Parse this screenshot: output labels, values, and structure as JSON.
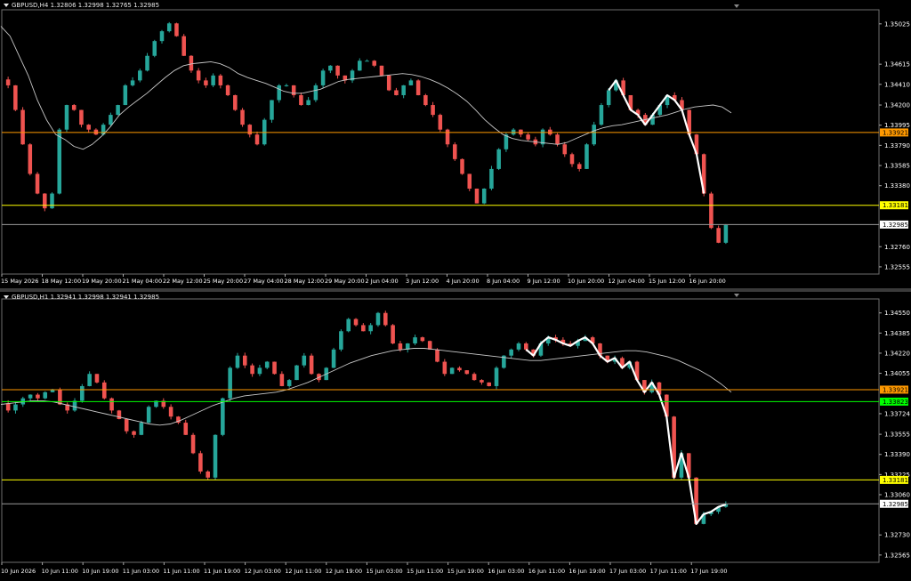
{
  "colors": {
    "bull": "#26a69a",
    "bear": "#ef5350",
    "ma": "#c8c8c8",
    "orange": "#ff9900",
    "yellow": "#ffff00",
    "green": "#00ff00",
    "current": "#9a9a9a",
    "pattern": "#ffffff",
    "axis_text": "#ffffff"
  },
  "chart_data": [
    {
      "type": "candlestick",
      "header": "GBPUSD,H4  1.32806 1.32998 1.32765 1.32985",
      "symbol": "GBPUSD",
      "timeframe": "H4",
      "ohlc": {
        "open": 1.32806,
        "high": 1.32998,
        "low": 1.32765,
        "close": 1.32985
      },
      "ylim": [
        1.325,
        1.3515
      ],
      "y_ticks": [
        "1.35025",
        "1.34615",
        "1.34410",
        "1.34200",
        "1.33995",
        "1.33790",
        "1.33585",
        "1.33380",
        "1.33181",
        "1.32985",
        "1.32760",
        "1.32555"
      ],
      "x_ticks": [
        "15 May 2026",
        "18 May 12:00",
        "19 May 20:00",
        "21 May 04:00",
        "22 May 12:00",
        "25 May 20:00",
        "27 May 04:00",
        "28 May 12:00",
        "29 May 20:00",
        "2 Jun 04:00",
        "3 Jun 12:00",
        "4 Jun 20:00",
        "8 Jun 04:00",
        "9 Jun 12:00",
        "10 Jun 20:00",
        "12 Jun 04:00",
        "15 Jun 12:00",
        "16 Jun 20:00"
      ],
      "levels": [
        {
          "name": "orange-level",
          "value": 1.33921,
          "label": "1.33921",
          "color": "orange"
        },
        {
          "name": "yellow-level",
          "value": 1.33181,
          "label": "1.33181",
          "color": "yellow"
        },
        {
          "name": "current-price",
          "value": 1.32985,
          "label": "1.32985",
          "color": "current"
        }
      ],
      "price_path": [
        1.344,
        1.3415,
        1.338,
        1.335,
        1.333,
        1.3315,
        1.333,
        1.3395,
        1.342,
        1.3415,
        1.34,
        1.3395,
        1.339,
        1.34,
        1.341,
        1.342,
        1.344,
        1.3445,
        1.3455,
        1.347,
        1.3485,
        1.3495,
        1.3503,
        1.349,
        1.347,
        1.3455,
        1.3445,
        1.344,
        1.345,
        1.344,
        1.343,
        1.3415,
        1.34,
        1.339,
        1.338,
        1.3405,
        1.3425,
        1.344,
        1.344,
        1.343,
        1.342,
        1.3425,
        1.344,
        1.3455,
        1.346,
        1.345,
        1.3445,
        1.3455,
        1.3465,
        1.3465,
        1.346,
        1.345,
        1.3435,
        1.343,
        1.344,
        1.3445,
        1.343,
        1.342,
        1.341,
        1.3395,
        1.338,
        1.3365,
        1.335,
        1.3335,
        1.332,
        1.3335,
        1.3355,
        1.3375,
        1.339,
        1.3395,
        1.339,
        1.3385,
        1.338,
        1.3395,
        1.339,
        1.338,
        1.337,
        1.336,
        1.3355,
        1.338,
        1.34,
        1.342,
        1.3435,
        1.3445,
        1.343,
        1.3415,
        1.341,
        1.34,
        1.341,
        1.342,
        1.343,
        1.3425,
        1.3415,
        1.339,
        1.337,
        1.333,
        1.3295,
        1.328,
        1.3298
      ],
      "ma_path": [
        1.35,
        1.349,
        1.347,
        1.345,
        1.3425,
        1.3405,
        1.339,
        1.3385,
        1.3378,
        1.3375,
        1.338,
        1.3388,
        1.3398,
        1.341,
        1.3418,
        1.3425,
        1.3432,
        1.344,
        1.3448,
        1.3455,
        1.346,
        1.3462,
        1.3463,
        1.3464,
        1.3462,
        1.3458,
        1.3452,
        1.3448,
        1.3445,
        1.3442,
        1.3438,
        1.3434,
        1.3432,
        1.3432,
        1.3434,
        1.3436,
        1.344,
        1.3444,
        1.3446,
        1.3447,
        1.3448,
        1.3449,
        1.345,
        1.3451,
        1.3452,
        1.3451,
        1.3449,
        1.3446,
        1.3442,
        1.3437,
        1.3431,
        1.3424,
        1.3415,
        1.3405,
        1.3397,
        1.339,
        1.3386,
        1.3384,
        1.3383,
        1.3382,
        1.3381,
        1.338,
        1.3382,
        1.3386,
        1.339,
        1.3394,
        1.3397,
        1.3399,
        1.34,
        1.3402,
        1.3404,
        1.3406,
        1.3408,
        1.341,
        1.3413,
        1.3416,
        1.3418,
        1.3419,
        1.342,
        1.3418,
        1.3412
      ]
    },
    {
      "type": "candlestick",
      "header": "GBPUSD,H1  1.32941 1.32998 1.32941 1.32985",
      "symbol": "GBPUSD",
      "timeframe": "H1",
      "ohlc": {
        "open": 1.32941,
        "high": 1.32998,
        "low": 1.32941,
        "close": 1.32985
      },
      "ylim": [
        1.3252,
        1.3465
      ],
      "y_ticks": [
        "1.34550",
        "1.34385",
        "1.34220",
        "1.34055",
        "1.33921",
        "1.33823",
        "1.33724",
        "1.33555",
        "1.33390",
        "1.33225",
        "1.33181",
        "1.33060",
        "1.32985",
        "1.32730",
        "1.32565"
      ],
      "x_ticks": [
        "10 Jun 2026",
        "10 Jun 11:00",
        "10 Jun 19:00",
        "11 Jun 03:00",
        "11 Jun 11:00",
        "11 Jun 19:00",
        "12 Jun 03:00",
        "12 Jun 11:00",
        "12 Jun 19:00",
        "15 Jun 03:00",
        "15 Jun 11:00",
        "15 Jun 19:00",
        "16 Jun 03:00",
        "16 Jun 11:00",
        "16 Jun 19:00",
        "17 Jun 03:00",
        "17 Jun 11:00",
        "17 Jun 19:00"
      ],
      "levels": [
        {
          "name": "orange-level",
          "value": 1.33921,
          "label": "1.33921",
          "color": "orange"
        },
        {
          "name": "green-level",
          "value": 1.33823,
          "label": "1.33823",
          "color": "green"
        },
        {
          "name": "yellow-level",
          "value": 1.33181,
          "label": "1.33181",
          "color": "yellow"
        },
        {
          "name": "current-price",
          "value": 1.32985,
          "label": "1.32985",
          "color": "current"
        }
      ],
      "price_path": [
        1.3375,
        1.338,
        1.3385,
        1.3388,
        1.3385,
        1.339,
        1.3392,
        1.338,
        1.3375,
        1.3383,
        1.3395,
        1.3405,
        1.3398,
        1.3385,
        1.3375,
        1.3368,
        1.3358,
        1.3355,
        1.3365,
        1.3378,
        1.3383,
        1.3378,
        1.337,
        1.3365,
        1.3355,
        1.334,
        1.3325,
        1.332,
        1.3355,
        1.3385,
        1.341,
        1.342,
        1.3412,
        1.3405,
        1.341,
        1.3415,
        1.3405,
        1.3395,
        1.34,
        1.3412,
        1.342,
        1.3405,
        1.34,
        1.341,
        1.3425,
        1.344,
        1.345,
        1.3445,
        1.344,
        1.3445,
        1.3455,
        1.3445,
        1.343,
        1.3425,
        1.343,
        1.3435,
        1.3432,
        1.3425,
        1.3415,
        1.3405,
        1.341,
        1.3408,
        1.3405,
        1.34,
        1.3398,
        1.3395,
        1.341,
        1.342,
        1.3425,
        1.343,
        1.3425,
        1.342,
        1.343,
        1.3435,
        1.3433,
        1.343,
        1.3428,
        1.3432,
        1.3435,
        1.343,
        1.342,
        1.3415,
        1.3418,
        1.341,
        1.3415,
        1.34,
        1.339,
        1.3398,
        1.3388,
        1.337,
        1.332,
        1.334,
        1.332,
        1.3282,
        1.329,
        1.3292,
        1.3296,
        1.3298
      ],
      "ma_path": [
        1.338,
        1.3381,
        1.3382,
        1.3383,
        1.3383,
        1.3382,
        1.338,
        1.3378,
        1.3376,
        1.3374,
        1.3372,
        1.337,
        1.3368,
        1.3366,
        1.3364,
        1.3363,
        1.3364,
        1.3367,
        1.3371,
        1.3375,
        1.3379,
        1.3382,
        1.3385,
        1.3387,
        1.3388,
        1.3389,
        1.339,
        1.3392,
        1.3395,
        1.3398,
        1.3402,
        1.3406,
        1.341,
        1.3414,
        1.3417,
        1.342,
        1.3422,
        1.3424,
        1.3425,
        1.3426,
        1.3426,
        1.3425,
        1.3424,
        1.3423,
        1.3422,
        1.3421,
        1.342,
        1.3419,
        1.3418,
        1.3417,
        1.3416,
        1.3416,
        1.3417,
        1.3418,
        1.3419,
        1.342,
        1.3421,
        1.3422,
        1.3423,
        1.3424,
        1.3424,
        1.3423,
        1.3421,
        1.3419,
        1.3416,
        1.3412,
        1.3408,
        1.3403,
        1.3397,
        1.339
      ]
    }
  ]
}
